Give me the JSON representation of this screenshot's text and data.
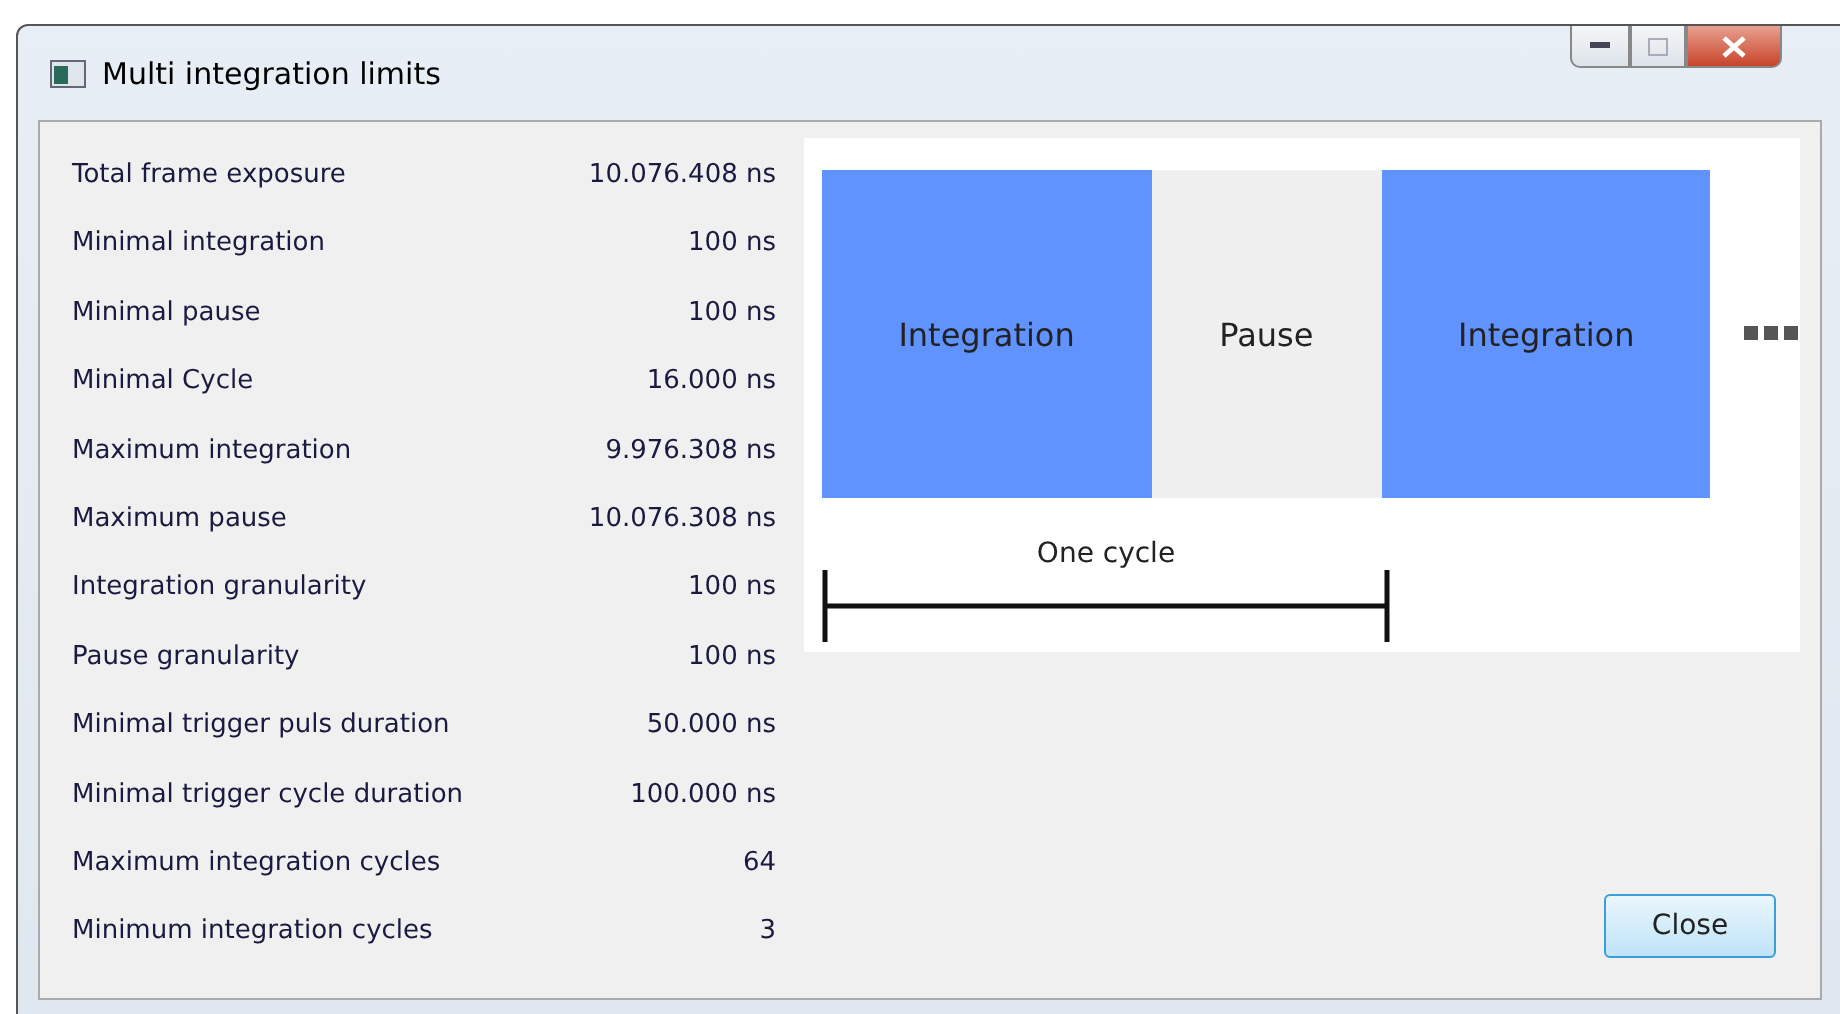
{
  "window": {
    "title": "Multi integration limits"
  },
  "limits": [
    {
      "label": "Total frame exposure",
      "value": "10.076.408 ns"
    },
    {
      "label": "Minimal integration",
      "value": "100 ns"
    },
    {
      "label": "Minimal pause",
      "value": "100 ns"
    },
    {
      "label": "Minimal Cycle",
      "value": "16.000 ns"
    },
    {
      "label": "Maximum integration",
      "value": "9.976.308 ns"
    },
    {
      "label": "Maximum pause",
      "value": "10.076.308 ns"
    },
    {
      "label": "Integration granularity",
      "value": "100 ns"
    },
    {
      "label": "Pause granularity",
      "value": "100 ns"
    },
    {
      "label": "Minimal trigger puls duration",
      "value": "50.000 ns"
    },
    {
      "label": "Minimal trigger cycle duration",
      "value": "100.000 ns"
    },
    {
      "label": "Maximum integration cycles",
      "value": "64"
    },
    {
      "label": "Minimum integration cycles",
      "value": "3"
    }
  ],
  "diagram": {
    "segments": [
      {
        "kind": "integration",
        "label": "Integration"
      },
      {
        "kind": "pause",
        "label": "Pause"
      },
      {
        "kind": "integration",
        "label": "Integration"
      }
    ],
    "cycle_label": "One cycle"
  },
  "buttons": {
    "close": "Close"
  }
}
